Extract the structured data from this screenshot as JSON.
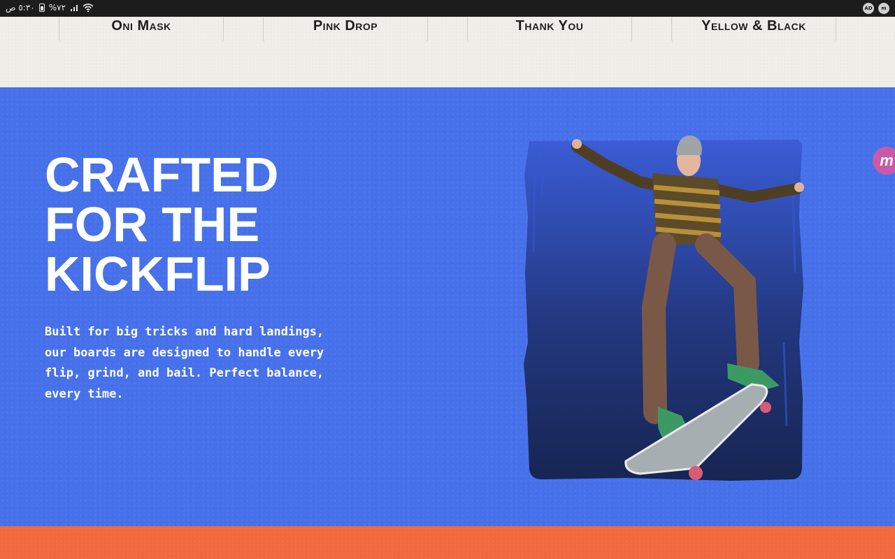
{
  "status_bar": {
    "time": "٥:٣٠ ص",
    "battery": "%٧٢",
    "right_badges": [
      "AD",
      "m"
    ]
  },
  "product_strip": {
    "items": [
      {
        "label": "Oni Mask"
      },
      {
        "label": "Pink Drop"
      },
      {
        "label": "Thank You"
      },
      {
        "label": "Yellow & Black"
      }
    ]
  },
  "hero": {
    "headline_lines": [
      "CRAFTED",
      "FOR THE",
      "KICKFLIP"
    ],
    "body": "Built for big tricks and hard landings, our boards are designed to handle every flip, grind, and bail. Perfect balance, every time.",
    "image_alt": "Skateboarder mid-kickflip on a blue painted background"
  },
  "chat_widget": {
    "label": "m"
  },
  "colors": {
    "hero_bg": "#4771ea",
    "strip_bg": "#efeee9",
    "orange_band": "#f0693f",
    "text_on_blue": "#ffffff"
  }
}
